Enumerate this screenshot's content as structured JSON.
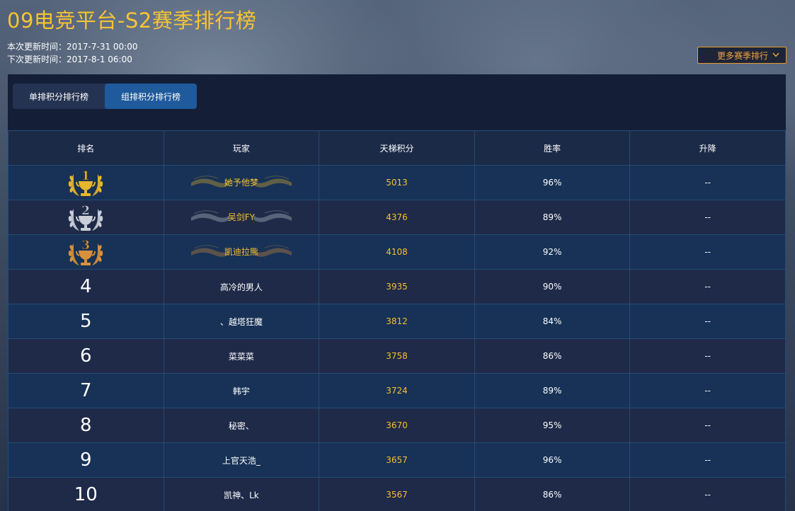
{
  "page": {
    "title": "09电竞平台-S2赛季排行榜",
    "current_update": "本次更新时间：2017-7-31 00:00",
    "next_update": "下次更新时间：2017-8-1 06:00",
    "more_button": "更多赛季排行",
    "accent_color": "#f7c432"
  },
  "tabs": [
    {
      "label": "单排积分排行榜",
      "active": false
    },
    {
      "label": "组排积分排行榜",
      "active": true
    }
  ],
  "table": {
    "headers": [
      "排名",
      "玩家",
      "天梯积分",
      "胜率",
      "升降"
    ],
    "rows": [
      {
        "rank": "1",
        "player": "她予他梦",
        "score": "5013",
        "win_rate": "96%",
        "change": "--"
      },
      {
        "rank": "2",
        "player": "吴剑FY",
        "score": "4376",
        "win_rate": "89%",
        "change": "--"
      },
      {
        "rank": "3",
        "player": "凯迪拉熊",
        "score": "4108",
        "win_rate": "92%",
        "change": "--"
      },
      {
        "rank": "4",
        "player": "高冷的男人",
        "score": "3935",
        "win_rate": "90%",
        "change": "--"
      },
      {
        "rank": "5",
        "player": "、越塔狂魔",
        "score": "3812",
        "win_rate": "84%",
        "change": "--"
      },
      {
        "rank": "6",
        "player": "菜菜菜",
        "score": "3758",
        "win_rate": "86%",
        "change": "--"
      },
      {
        "rank": "7",
        "player": "韩宇",
        "score": "3724",
        "win_rate": "89%",
        "change": "--"
      },
      {
        "rank": "8",
        "player": "秘密、",
        "score": "3670",
        "win_rate": "95%",
        "change": "--"
      },
      {
        "rank": "9",
        "player": "上官天浩_",
        "score": "3657",
        "win_rate": "96%",
        "change": "--"
      },
      {
        "rank": "10",
        "player": "凯神、Lk",
        "score": "3567",
        "win_rate": "86%",
        "change": "--"
      }
    ]
  },
  "medal_colors": [
    "#e8b62a",
    "#c9ced8",
    "#d9903a"
  ]
}
